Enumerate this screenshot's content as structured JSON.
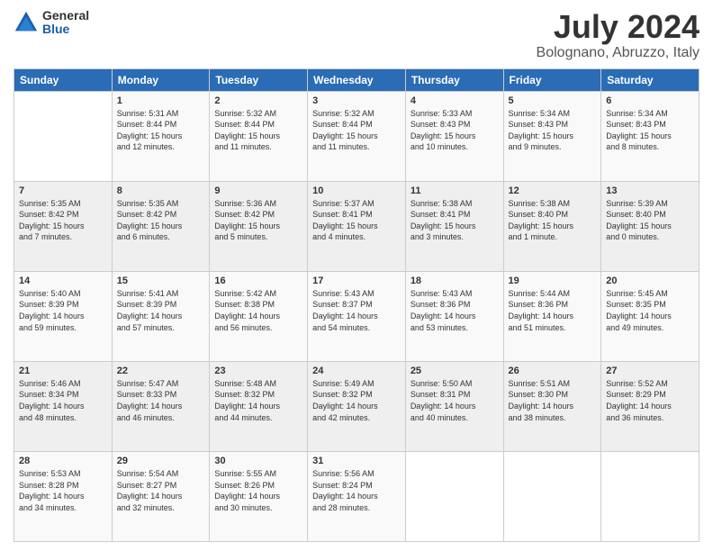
{
  "logo": {
    "general": "General",
    "blue": "Blue"
  },
  "title": "July 2024",
  "subtitle": "Bolognano, Abruzzo, Italy",
  "headers": [
    "Sunday",
    "Monday",
    "Tuesday",
    "Wednesday",
    "Thursday",
    "Friday",
    "Saturday"
  ],
  "weeks": [
    [
      {
        "day": "",
        "content": ""
      },
      {
        "day": "1",
        "content": "Sunrise: 5:31 AM\nSunset: 8:44 PM\nDaylight: 15 hours\nand 12 minutes."
      },
      {
        "day": "2",
        "content": "Sunrise: 5:32 AM\nSunset: 8:44 PM\nDaylight: 15 hours\nand 11 minutes."
      },
      {
        "day": "3",
        "content": "Sunrise: 5:32 AM\nSunset: 8:44 PM\nDaylight: 15 hours\nand 11 minutes."
      },
      {
        "day": "4",
        "content": "Sunrise: 5:33 AM\nSunset: 8:43 PM\nDaylight: 15 hours\nand 10 minutes."
      },
      {
        "day": "5",
        "content": "Sunrise: 5:34 AM\nSunset: 8:43 PM\nDaylight: 15 hours\nand 9 minutes."
      },
      {
        "day": "6",
        "content": "Sunrise: 5:34 AM\nSunset: 8:43 PM\nDaylight: 15 hours\nand 8 minutes."
      }
    ],
    [
      {
        "day": "7",
        "content": "Sunrise: 5:35 AM\nSunset: 8:42 PM\nDaylight: 15 hours\nand 7 minutes."
      },
      {
        "day": "8",
        "content": "Sunrise: 5:35 AM\nSunset: 8:42 PM\nDaylight: 15 hours\nand 6 minutes."
      },
      {
        "day": "9",
        "content": "Sunrise: 5:36 AM\nSunset: 8:42 PM\nDaylight: 15 hours\nand 5 minutes."
      },
      {
        "day": "10",
        "content": "Sunrise: 5:37 AM\nSunset: 8:41 PM\nDaylight: 15 hours\nand 4 minutes."
      },
      {
        "day": "11",
        "content": "Sunrise: 5:38 AM\nSunset: 8:41 PM\nDaylight: 15 hours\nand 3 minutes."
      },
      {
        "day": "12",
        "content": "Sunrise: 5:38 AM\nSunset: 8:40 PM\nDaylight: 15 hours\nand 1 minute."
      },
      {
        "day": "13",
        "content": "Sunrise: 5:39 AM\nSunset: 8:40 PM\nDaylight: 15 hours\nand 0 minutes."
      }
    ],
    [
      {
        "day": "14",
        "content": "Sunrise: 5:40 AM\nSunset: 8:39 PM\nDaylight: 14 hours\nand 59 minutes."
      },
      {
        "day": "15",
        "content": "Sunrise: 5:41 AM\nSunset: 8:39 PM\nDaylight: 14 hours\nand 57 minutes."
      },
      {
        "day": "16",
        "content": "Sunrise: 5:42 AM\nSunset: 8:38 PM\nDaylight: 14 hours\nand 56 minutes."
      },
      {
        "day": "17",
        "content": "Sunrise: 5:43 AM\nSunset: 8:37 PM\nDaylight: 14 hours\nand 54 minutes."
      },
      {
        "day": "18",
        "content": "Sunrise: 5:43 AM\nSunset: 8:36 PM\nDaylight: 14 hours\nand 53 minutes."
      },
      {
        "day": "19",
        "content": "Sunrise: 5:44 AM\nSunset: 8:36 PM\nDaylight: 14 hours\nand 51 minutes."
      },
      {
        "day": "20",
        "content": "Sunrise: 5:45 AM\nSunset: 8:35 PM\nDaylight: 14 hours\nand 49 minutes."
      }
    ],
    [
      {
        "day": "21",
        "content": "Sunrise: 5:46 AM\nSunset: 8:34 PM\nDaylight: 14 hours\nand 48 minutes."
      },
      {
        "day": "22",
        "content": "Sunrise: 5:47 AM\nSunset: 8:33 PM\nDaylight: 14 hours\nand 46 minutes."
      },
      {
        "day": "23",
        "content": "Sunrise: 5:48 AM\nSunset: 8:32 PM\nDaylight: 14 hours\nand 44 minutes."
      },
      {
        "day": "24",
        "content": "Sunrise: 5:49 AM\nSunset: 8:32 PM\nDaylight: 14 hours\nand 42 minutes."
      },
      {
        "day": "25",
        "content": "Sunrise: 5:50 AM\nSunset: 8:31 PM\nDaylight: 14 hours\nand 40 minutes."
      },
      {
        "day": "26",
        "content": "Sunrise: 5:51 AM\nSunset: 8:30 PM\nDaylight: 14 hours\nand 38 minutes."
      },
      {
        "day": "27",
        "content": "Sunrise: 5:52 AM\nSunset: 8:29 PM\nDaylight: 14 hours\nand 36 minutes."
      }
    ],
    [
      {
        "day": "28",
        "content": "Sunrise: 5:53 AM\nSunset: 8:28 PM\nDaylight: 14 hours\nand 34 minutes."
      },
      {
        "day": "29",
        "content": "Sunrise: 5:54 AM\nSunset: 8:27 PM\nDaylight: 14 hours\nand 32 minutes."
      },
      {
        "day": "30",
        "content": "Sunrise: 5:55 AM\nSunset: 8:26 PM\nDaylight: 14 hours\nand 30 minutes."
      },
      {
        "day": "31",
        "content": "Sunrise: 5:56 AM\nSunset: 8:24 PM\nDaylight: 14 hours\nand 28 minutes."
      },
      {
        "day": "",
        "content": ""
      },
      {
        "day": "",
        "content": ""
      },
      {
        "day": "",
        "content": ""
      }
    ]
  ]
}
